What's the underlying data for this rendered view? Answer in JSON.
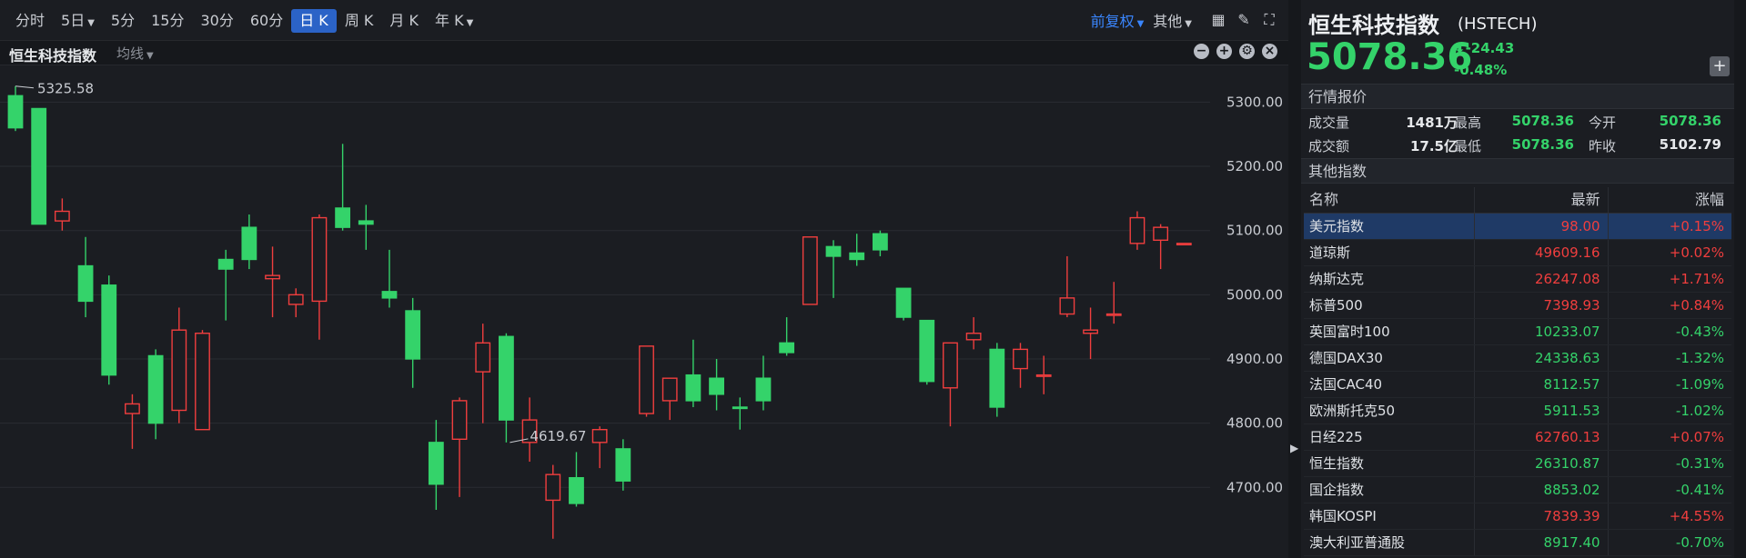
{
  "toolbar": {
    "periods": [
      {
        "label": "分时",
        "caret": false,
        "active": false
      },
      {
        "label": "5日",
        "caret": true,
        "active": false
      },
      {
        "label": "5分",
        "caret": false,
        "active": false
      },
      {
        "label": "15分",
        "caret": false,
        "active": false
      },
      {
        "label": "30分",
        "caret": false,
        "active": false
      },
      {
        "label": "60分",
        "caret": false,
        "active": false
      },
      {
        "label": "日 K",
        "caret": false,
        "active": true
      },
      {
        "label": "周 K",
        "caret": false,
        "active": false
      },
      {
        "label": "月 K",
        "caret": false,
        "active": false
      },
      {
        "label": "年 K",
        "caret": true,
        "active": false
      }
    ],
    "adjust_label": "前复权",
    "other_label": "其他"
  },
  "subbar": {
    "title": "恒生科技指数",
    "ma_label": "均线"
  },
  "chart_data": {
    "type": "candlestick",
    "ylim": [
      4590,
      5360
    ],
    "yticks": [
      "5300.00",
      "5200.00",
      "5100.00",
      "5000.00",
      "4900.00",
      "4800.00",
      "4700.00"
    ],
    "ytick_values": [
      5300,
      5200,
      5100,
      5000,
      4900,
      4800,
      4700
    ],
    "max_label": "5325.58",
    "min_label": "4619.67",
    "max_index": 0,
    "min_index": 21,
    "up_color": "#f03e3e",
    "down_color": "#34d36a",
    "candles": [
      [
        5310,
        5325,
        5255,
        5260
      ],
      [
        5290,
        5290,
        5110,
        5110
      ],
      [
        5115,
        5150,
        5100,
        5130
      ],
      [
        5045,
        5090,
        4965,
        4990
      ],
      [
        5015,
        5030,
        4860,
        4875
      ],
      [
        4815,
        4845,
        4760,
        4830
      ],
      [
        4905,
        4915,
        4775,
        4800
      ],
      [
        4820,
        4980,
        4800,
        4945
      ],
      [
        4790,
        4945,
        4790,
        4940
      ],
      [
        5055,
        5070,
        4960,
        5040
      ],
      [
        5105,
        5125,
        5040,
        5055
      ],
      [
        5025,
        5075,
        4965,
        5030
      ],
      [
        4985,
        5010,
        4965,
        5000
      ],
      [
        4990,
        5125,
        4930,
        5120
      ],
      [
        5135,
        5235,
        5100,
        5105
      ],
      [
        5115,
        5140,
        5070,
        5110
      ],
      [
        5005,
        5070,
        4980,
        4995
      ],
      [
        4975,
        4995,
        4855,
        4900
      ],
      [
        4770,
        4805,
        4665,
        4705
      ],
      [
        4775,
        4840,
        4685,
        4835
      ],
      [
        4880,
        4955,
        4800,
        4925
      ],
      [
        4935,
        4940,
        4770,
        4805
      ],
      [
        4770,
        4840,
        4740,
        4805
      ],
      [
        4680,
        4735,
        4620,
        4720
      ],
      [
        4715,
        4755,
        4670,
        4675
      ],
      [
        4770,
        4795,
        4730,
        4790
      ],
      [
        4760,
        4775,
        4695,
        4710
      ],
      [
        4815,
        4920,
        4810,
        4920
      ],
      [
        4835,
        4865,
        4805,
        4870
      ],
      [
        4875,
        4930,
        4825,
        4835
      ],
      [
        4870,
        4900,
        4820,
        4845
      ],
      [
        4825,
        4840,
        4790,
        4823
      ],
      [
        4870,
        4905,
        4820,
        4835
      ],
      [
        4925,
        4965,
        4905,
        4910
      ],
      [
        4985,
        5090,
        4985,
        5090
      ],
      [
        5075,
        5085,
        4995,
        5060
      ],
      [
        5065,
        5095,
        5045,
        5055
      ],
      [
        5095,
        5100,
        5060,
        5070
      ],
      [
        5010,
        5010,
        4960,
        4965
      ],
      [
        4960,
        4960,
        4860,
        4865
      ],
      [
        4855,
        4910,
        4795,
        4925
      ],
      [
        4930,
        4965,
        4915,
        4940
      ],
      [
        4915,
        4925,
        4810,
        4825
      ],
      [
        4885,
        4925,
        4855,
        4915
      ],
      [
        4875,
        4905,
        4845,
        4875
      ],
      [
        4970,
        5060,
        4965,
        4995
      ],
      [
        4940,
        4980,
        4900,
        4945
      ],
      [
        4970,
        5020,
        4955,
        4970
      ],
      [
        5080,
        5130,
        5070,
        5120
      ],
      [
        5085,
        5110,
        5040,
        5105
      ],
      [
        5080,
        5080,
        5080,
        5080
      ]
    ]
  },
  "quote": {
    "name": "恒生科技指数",
    "code": "(HSTECH)",
    "price": "5078.36",
    "change": "-24.43",
    "change_pct": "-0.48%",
    "section_title": "行情报价",
    "volume_label": "成交量",
    "volume": "1481万",
    "high_label": "最高",
    "high": "5078.36",
    "open_label": "今开",
    "open": "5078.36",
    "amount_label": "成交额",
    "amount": "17.5亿",
    "low_label": "最低",
    "low": "5078.36",
    "prev_label": "昨收",
    "prev_close": "5102.79"
  },
  "others": {
    "section_title": "其他指数",
    "headers": {
      "name": "名称",
      "last": "最新",
      "chg": "涨幅"
    },
    "rows": [
      {
        "name": "美元指数",
        "last": "98.00",
        "chg": "+0.15%",
        "up": true
      },
      {
        "name": "道琼斯",
        "last": "49609.16",
        "chg": "+0.02%",
        "up": true
      },
      {
        "name": "纳斯达克",
        "last": "26247.08",
        "chg": "+1.71%",
        "up": true
      },
      {
        "name": "标普500",
        "last": "7398.93",
        "chg": "+0.84%",
        "up": true
      },
      {
        "name": "英国富时100",
        "last": "10233.07",
        "chg": "-0.43%",
        "up": false
      },
      {
        "name": "德国DAX30",
        "last": "24338.63",
        "chg": "-1.32%",
        "up": false
      },
      {
        "name": "法国CAC40",
        "last": "8112.57",
        "chg": "-1.09%",
        "up": false
      },
      {
        "name": "欧洲斯托克50",
        "last": "5911.53",
        "chg": "-1.02%",
        "up": false
      },
      {
        "name": "日经225",
        "last": "62760.13",
        "chg": "+0.07%",
        "up": true
      },
      {
        "name": "恒生指数",
        "last": "26310.87",
        "chg": "-0.31%",
        "up": false
      },
      {
        "name": "国企指数",
        "last": "8853.02",
        "chg": "-0.41%",
        "up": false
      },
      {
        "name": "韩国KOSPI",
        "last": "7839.39",
        "chg": "+4.55%",
        "up": true
      },
      {
        "name": "澳大利亚普通股",
        "last": "8917.40",
        "chg": "-0.70%",
        "up": false
      }
    ]
  }
}
